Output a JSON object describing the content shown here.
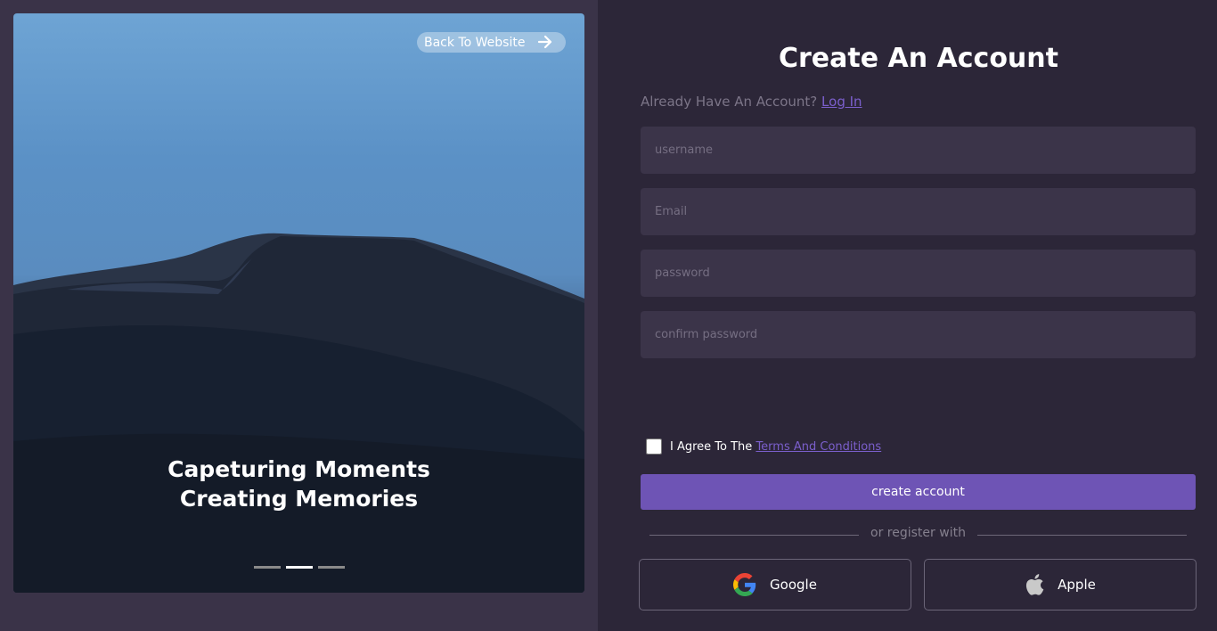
{
  "hero": {
    "back_label": "Back To Website",
    "caption_line1": "Capeturing Moments",
    "caption_line2": "Creating Memories",
    "slides": 3,
    "active_slide": 2
  },
  "form": {
    "title": "Create An Account",
    "login_prompt": "Already Have An Account?",
    "login_link": "Log In",
    "fields": {
      "username": "username",
      "email": "Email",
      "password": "password",
      "confirm": "confirm password"
    },
    "agree_text": "I Agree To The",
    "terms_link": "Terms And Conditions",
    "submit_label": "create account",
    "divider_text": "or register with",
    "google_label": "Google",
    "apple_label": "Apple"
  },
  "colors": {
    "accent": "#6e54b5",
    "link": "#7b5fcc",
    "background": "#2c2638",
    "input_bg": "#3b3449"
  }
}
